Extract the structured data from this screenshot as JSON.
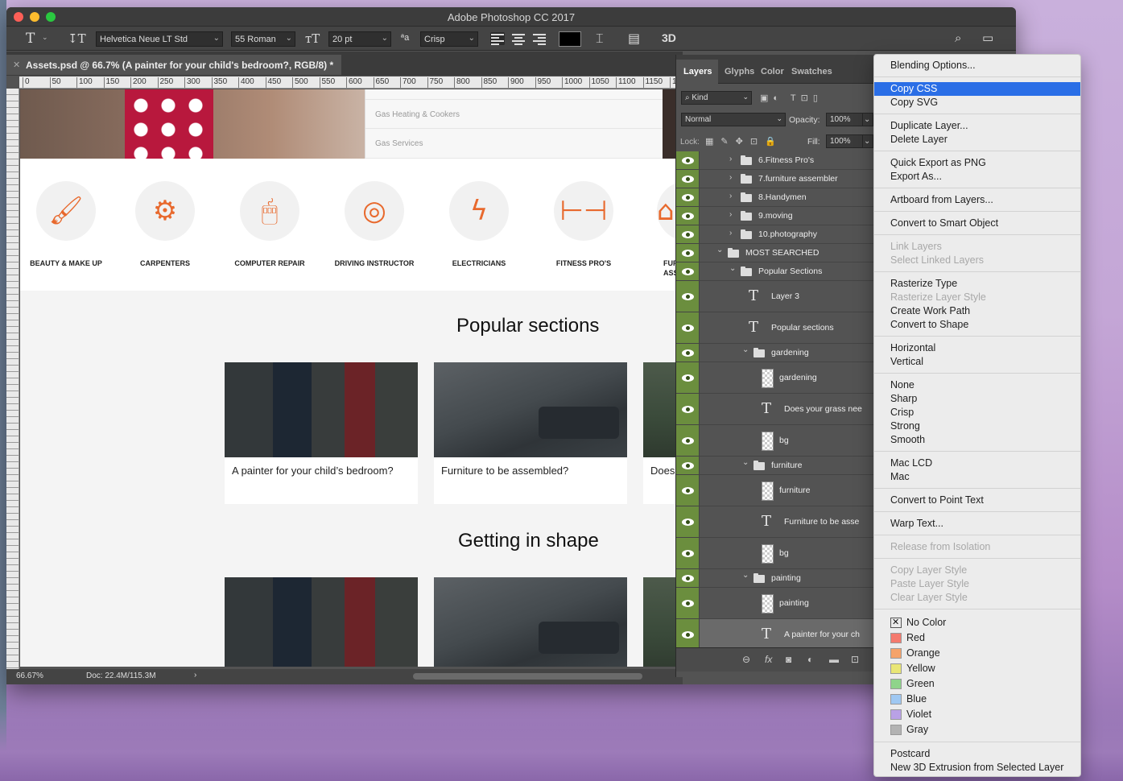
{
  "window": {
    "title": "Adobe Photoshop CC 2017",
    "doc_tab": "Assets.psd @ 66.7% (A painter for your child's bedroom?, RGB/8) *"
  },
  "options": {
    "font_family": "Helvetica Neue LT Std",
    "font_style": "55 Roman",
    "font_size": "20 pt",
    "aa_label": "ªa",
    "antialias": "Crisp",
    "three_d": "3D",
    "color": "#000000"
  },
  "ruler": [
    "0",
    "50",
    "100",
    "150",
    "200",
    "250",
    "300",
    "350",
    "400",
    "450",
    "500",
    "550",
    "600",
    "650",
    "700",
    "750",
    "800",
    "850",
    "900",
    "950",
    "1000",
    "1050",
    "1100",
    "1150",
    "120"
  ],
  "canvas": {
    "dropdown_items": [
      "Gas Heating & Cookers",
      "Gas Services"
    ],
    "services": [
      {
        "label": "BEAUTY & MAKE UP",
        "icon": "nail-polish-icon",
        "glyph": "🖌"
      },
      {
        "label": "CARPENTERS",
        "icon": "saw-blade-icon",
        "glyph": "⚙"
      },
      {
        "label": "COMPUTER REPAIR",
        "icon": "mouse-icon",
        "glyph": "🖱"
      },
      {
        "label": "DRIVING INSTRUCTOR",
        "icon": "steering-wheel-icon",
        "glyph": "◎"
      },
      {
        "label": "ELECTRICIANS",
        "icon": "lightning-icon",
        "glyph": "ϟ"
      },
      {
        "label": "FITNESS PRO'S",
        "icon": "dumbbell-icon",
        "glyph": "⊢⊣"
      },
      {
        "label": "FUR\nASSE",
        "icon": "chair-icon",
        "glyph": "⌂"
      }
    ],
    "section1_title": "Popular sections",
    "section2_title": "Getting in shape",
    "cards1": [
      "A painter for your child’s bedroom?",
      "Furniture to be assembled?",
      "Does y"
    ],
    "status_zoom": "66.67%",
    "status_doc": "Doc: 22.4M/115.3M",
    "status_arrow": "›"
  },
  "layers_panel": {
    "tabs": [
      "Layers",
      "Glyphs",
      "Color",
      "Swatches"
    ],
    "kind_label": "Kind",
    "blend_mode": "Normal",
    "opacity_label": "Opacity:",
    "opacity": "100%",
    "lock_label": "Lock:",
    "fill_label": "Fill:",
    "fill": "100%",
    "layers": [
      {
        "name": "6.Fitness Pro's",
        "type": "group",
        "open": false,
        "indent": 1
      },
      {
        "name": "7.furniture assembler",
        "type": "group",
        "open": false,
        "indent": 1
      },
      {
        "name": "8.Handymen",
        "type": "group",
        "open": false,
        "indent": 1
      },
      {
        "name": "9.moving",
        "type": "group",
        "open": false,
        "indent": 1
      },
      {
        "name": "10.photography",
        "type": "group",
        "open": false,
        "indent": 1
      },
      {
        "name": "MOST SEARCHED",
        "type": "group",
        "open": true,
        "indent": 0
      },
      {
        "name": "Popular Sections",
        "type": "group",
        "open": true,
        "indent": 1
      },
      {
        "name": "Layer 3",
        "type": "text",
        "indent": 2
      },
      {
        "name": "Popular sections",
        "type": "text",
        "indent": 2
      },
      {
        "name": "gardening",
        "type": "group",
        "open": true,
        "indent": 2
      },
      {
        "name": "gardening",
        "type": "smart",
        "indent": 3
      },
      {
        "name": "Does your grass nee",
        "type": "text",
        "indent": 3
      },
      {
        "name": "bg",
        "type": "shape",
        "indent": 3
      },
      {
        "name": "furniture",
        "type": "group",
        "open": true,
        "indent": 2
      },
      {
        "name": "furniture",
        "type": "smart",
        "indent": 3
      },
      {
        "name": "Furniture to be asse",
        "type": "text",
        "indent": 3
      },
      {
        "name": "bg",
        "type": "shape",
        "indent": 3
      },
      {
        "name": "painting",
        "type": "group",
        "open": true,
        "indent": 2
      },
      {
        "name": "painting",
        "type": "smart",
        "indent": 3
      },
      {
        "name": "A painter for your ch",
        "type": "text",
        "indent": 3,
        "selected": true
      }
    ],
    "footer_icons": [
      "link-icon",
      "fx-icon",
      "mask-icon",
      "adjustment-icon",
      "folder-icon",
      "new-layer-icon"
    ]
  },
  "context_menu": {
    "items": [
      {
        "label": "Blending Options...",
        "state": "normal"
      },
      "sep",
      {
        "label": "Copy CSS",
        "state": "highlight"
      },
      {
        "label": "Copy SVG",
        "state": "normal"
      },
      "sep",
      {
        "label": "Duplicate Layer...",
        "state": "normal"
      },
      {
        "label": "Delete Layer",
        "state": "normal"
      },
      "sep",
      {
        "label": "Quick Export as PNG",
        "state": "normal"
      },
      {
        "label": "Export As...",
        "state": "normal"
      },
      "sep",
      {
        "label": "Artboard from Layers...",
        "state": "normal"
      },
      "sep",
      {
        "label": "Convert to Smart Object",
        "state": "normal"
      },
      "sep",
      {
        "label": "Link Layers",
        "state": "disabled"
      },
      {
        "label": "Select Linked Layers",
        "state": "disabled"
      },
      "sep",
      {
        "label": "Rasterize Type",
        "state": "normal"
      },
      {
        "label": "Rasterize Layer Style",
        "state": "disabled"
      },
      {
        "label": "Create Work Path",
        "state": "normal"
      },
      {
        "label": "Convert to Shape",
        "state": "normal"
      },
      "sep",
      {
        "label": "Horizontal",
        "state": "normal"
      },
      {
        "label": "Vertical",
        "state": "normal"
      },
      "sep",
      {
        "label": "None",
        "state": "normal"
      },
      {
        "label": "Sharp",
        "state": "normal"
      },
      {
        "label": "Crisp",
        "state": "normal"
      },
      {
        "label": "Strong",
        "state": "normal"
      },
      {
        "label": "Smooth",
        "state": "normal"
      },
      "sep",
      {
        "label": "Mac LCD",
        "state": "normal"
      },
      {
        "label": "Mac",
        "state": "normal"
      },
      "sep",
      {
        "label": "Convert to Point Text",
        "state": "normal"
      },
      "sep",
      {
        "label": "Warp Text...",
        "state": "normal"
      },
      "sep",
      {
        "label": "Release from Isolation",
        "state": "disabled"
      },
      "sep",
      {
        "label": "Copy Layer Style",
        "state": "disabled"
      },
      {
        "label": "Paste Layer Style",
        "state": "disabled"
      },
      {
        "label": "Clear Layer Style",
        "state": "disabled"
      },
      "sep"
    ],
    "colors": [
      {
        "label": "No Color",
        "hex": "none"
      },
      {
        "label": "Red",
        "hex": "#f47a6e"
      },
      {
        "label": "Orange",
        "hex": "#f5a36a"
      },
      {
        "label": "Yellow",
        "hex": "#e9e676"
      },
      {
        "label": "Green",
        "hex": "#8fd48a"
      },
      {
        "label": "Blue",
        "hex": "#9fc8f2"
      },
      {
        "label": "Violet",
        "hex": "#b9a1e6"
      },
      {
        "label": "Gray",
        "hex": "#b3b3b3"
      }
    ],
    "tail": [
      {
        "label": "Postcard",
        "state": "normal"
      },
      {
        "label": "New 3D Extrusion from Selected Layer",
        "state": "normal"
      }
    ]
  }
}
